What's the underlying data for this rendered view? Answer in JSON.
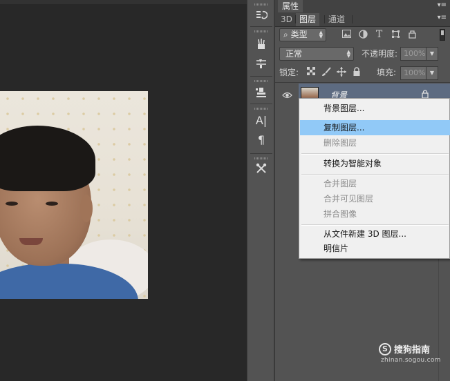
{
  "properties_panel": {
    "tab_label": "属性",
    "menu_icon": "panel-menu-icon"
  },
  "layers_panel": {
    "tabs": [
      {
        "label": "3D",
        "active": false
      },
      {
        "label": "图层",
        "active": true
      },
      {
        "label": "通道",
        "active": false
      }
    ],
    "filter": {
      "search_glyph": "⌕",
      "kind_label": "类型"
    },
    "blend_mode": "正常",
    "opacity_label": "不透明度:",
    "opacity_value": "100%",
    "lock_label": "锁定:",
    "fill_label": "填充:",
    "fill_value": "100%",
    "layer": {
      "name": "背景",
      "thumbnail": "portrait-photo",
      "visible": true,
      "locked": true
    }
  },
  "context_menu": {
    "items": [
      {
        "label": "背景图层...",
        "state": "normal"
      },
      {
        "label": "复制图层...",
        "state": "highlighted"
      },
      {
        "label": "删除图层",
        "state": "disabled"
      },
      {
        "separator": true
      },
      {
        "label": "转换为智能对象",
        "state": "normal"
      },
      {
        "separator": true
      },
      {
        "label": "合并图层",
        "state": "disabled"
      },
      {
        "label": "合并可见图层",
        "state": "disabled"
      },
      {
        "label": "拼合图像",
        "state": "disabled"
      },
      {
        "separator": true
      },
      {
        "label": "从文件新建 3D 图层...",
        "state": "normal"
      },
      {
        "label": "明信片",
        "state": "normal"
      }
    ]
  },
  "watermark": {
    "logo": "S",
    "title": "搜狗指南",
    "url": "zhinan.sogou.com"
  },
  "colors": {
    "highlight": "#91c9f7",
    "layer_selected": "#5d6b81",
    "panel": "#535353",
    "canvas_bg": "#282828"
  }
}
